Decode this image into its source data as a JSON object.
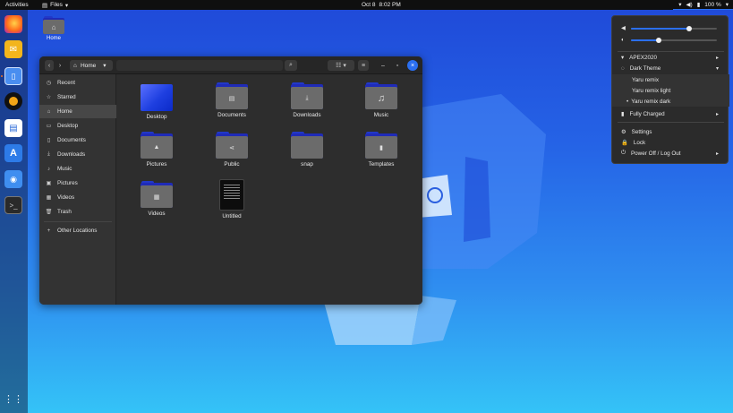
{
  "topbar": {
    "activities": "Activities",
    "app_name": "Files",
    "date": "Oct 8",
    "time": "8:02 PM",
    "battery": "100 %"
  },
  "desktop": {
    "home_label": "Home"
  },
  "dock": {
    "items": [
      "firefox-icon",
      "mail-icon",
      "phone-icon",
      "music-player-icon",
      "document-editor-icon",
      "app-store-icon",
      "screenshot-icon",
      "terminal-icon",
      "show-apps-icon"
    ]
  },
  "files": {
    "path": "Home",
    "sidebar": [
      {
        "label": "Recent",
        "icon": "clock-icon"
      },
      {
        "label": "Starred",
        "icon": "star-icon"
      },
      {
        "label": "Home",
        "icon": "home-icon",
        "selected": true
      },
      {
        "label": "Desktop",
        "icon": "desktop-icon"
      },
      {
        "label": "Documents",
        "icon": "document-icon"
      },
      {
        "label": "Downloads",
        "icon": "download-icon"
      },
      {
        "label": "Music",
        "icon": "music-icon"
      },
      {
        "label": "Pictures",
        "icon": "picture-icon"
      },
      {
        "label": "Videos",
        "icon": "video-icon"
      },
      {
        "label": "Trash",
        "icon": "trash-icon"
      },
      {
        "label": "Other Locations",
        "icon": "plus-icon"
      }
    ],
    "items": [
      {
        "label": "Desktop",
        "type": "desktop"
      },
      {
        "label": "Documents",
        "type": "folder",
        "glyph": "📄"
      },
      {
        "label": "Downloads",
        "type": "folder",
        "glyph": "⤓"
      },
      {
        "label": "Music",
        "type": "folder",
        "glyph": "♫"
      },
      {
        "label": "Pictures",
        "type": "folder",
        "glyph": "▲"
      },
      {
        "label": "Public",
        "type": "folder",
        "glyph": "⋖"
      },
      {
        "label": "snap",
        "type": "folder",
        "glyph": ""
      },
      {
        "label": "Templates",
        "type": "folder",
        "glyph": "▮"
      },
      {
        "label": "Videos",
        "type": "folder",
        "glyph": "▦"
      },
      {
        "label": "Untitled",
        "type": "document"
      }
    ]
  },
  "sysmenu": {
    "volume_level": 0.68,
    "brightness_level": 0.32,
    "wifi": "APEX2020",
    "theme": "Dark Theme",
    "theme_options": [
      "Yaru remix",
      "Yaru remix light",
      "Yaru remix dark"
    ],
    "theme_selected_marker": "•",
    "battery": "Fully Charged",
    "settings": "Settings",
    "lock": "Lock",
    "power": "Power Off / Log Out"
  },
  "colors": {
    "accent": "#2b6ff0",
    "folder_tab": "#1f2bb8",
    "window_bg": "#2d2d2d"
  }
}
